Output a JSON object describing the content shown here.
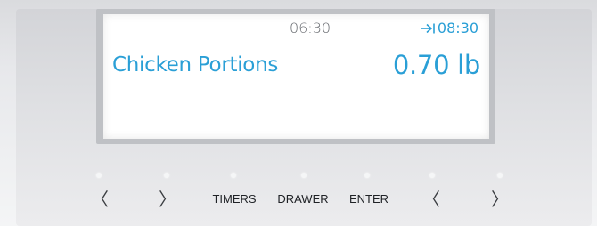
{
  "display": {
    "clock": "06:30",
    "end_time": "08:30",
    "end_icon": "arrow-to-bar-icon",
    "food_name": "Chicken Portions",
    "weight": "0.70 lb",
    "accent_color": "#2a9fd6",
    "clock_color": "#6b6e73"
  },
  "controls": {
    "left_chevron_1": "〈",
    "right_chevron_1": "〉",
    "timers": "TIMERS",
    "drawer": "DRAWER",
    "enter": "ENTER",
    "left_chevron_2": "〈",
    "right_chevron_2": "〉"
  }
}
